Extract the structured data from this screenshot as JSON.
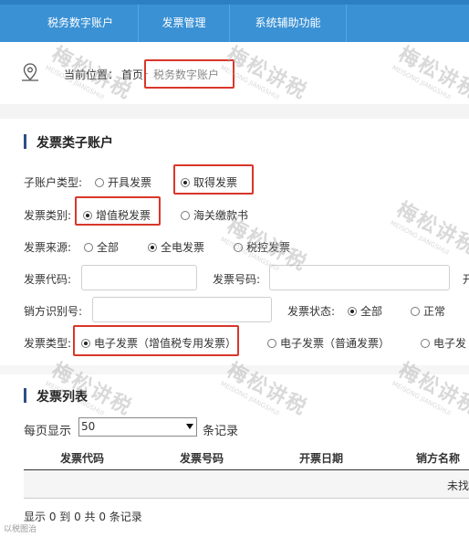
{
  "nav": {
    "items": [
      "税务数字账户",
      "发票管理",
      "系统辅助功能"
    ]
  },
  "breadcrumb": {
    "current_label": "当前位置：",
    "home": "首页",
    "separator": "-",
    "page": "税务数字账户"
  },
  "subaccount": {
    "title": "发票类子账户",
    "account_type": {
      "label": "子账户类型:",
      "options": [
        "开具发票",
        "取得发票"
      ],
      "selected": "取得发票"
    },
    "category": {
      "label": "发票类别:",
      "options": [
        "增值税发票",
        "海关缴款书"
      ],
      "selected": "增值税发票"
    },
    "source": {
      "label": "发票来源:",
      "options": [
        "全部",
        "全电发票",
        "税控发票"
      ],
      "selected": "全电发票"
    },
    "invoice_code_label": "发票代码:",
    "invoice_number_label": "发票号码:",
    "cut_label": "开",
    "seller_id_label": "销方识别号:",
    "status": {
      "label": "发票状态:",
      "options": [
        "全部",
        "正常"
      ],
      "selected": "全部"
    },
    "invoice_type": {
      "label": "发票类型:",
      "options": [
        "电子发票（增值税专用发票）",
        "电子发票（普通发票）",
        "电子发"
      ],
      "selected": "电子发票（增值税专用发票）"
    }
  },
  "list": {
    "title": "发票列表",
    "per_page_prefix": "每页显示",
    "per_page_value": "50",
    "per_page_suffix": "条记录",
    "columns": [
      "发票代码",
      "发票号码",
      "开票日期",
      "销方名称"
    ],
    "empty_text": "未找",
    "footer": "显示 0 到 0 共 0 条记录"
  },
  "watermark": {
    "text": "梅松讲税",
    "sub": "MEISONG JIANGSHUI"
  },
  "corner_logo": "以税图治",
  "colors": {
    "nav_bg": "#3a91d4",
    "highlight_box": "#d9362a",
    "section_bar": "#2f4d87"
  }
}
